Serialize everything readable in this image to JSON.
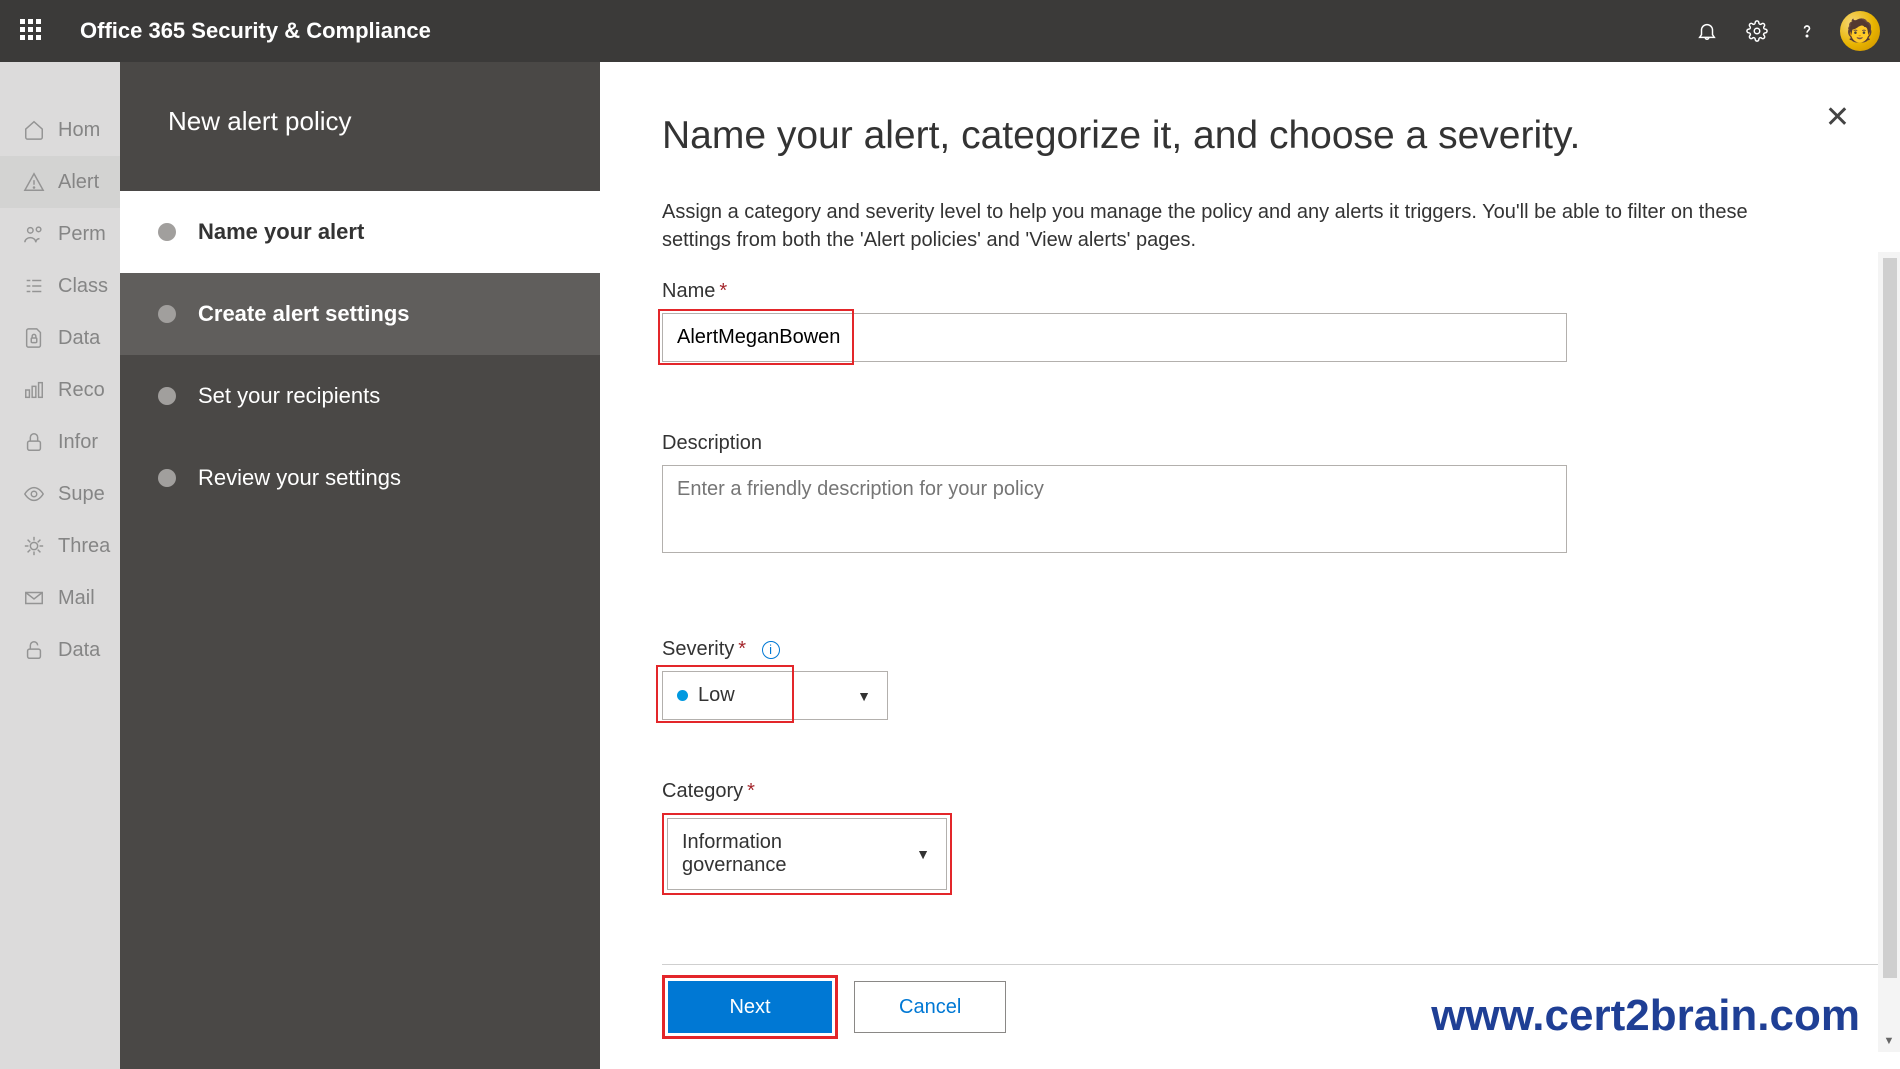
{
  "header": {
    "app_title": "Office 365 Security & Compliance"
  },
  "left_nav": {
    "items": [
      {
        "label": "Hom"
      },
      {
        "label": "Alert"
      },
      {
        "label": "Perm"
      },
      {
        "label": "Class"
      },
      {
        "label": "Data"
      },
      {
        "label": "Reco"
      },
      {
        "label": "Infor"
      },
      {
        "label": "Supe"
      },
      {
        "label": "Threa"
      },
      {
        "label": "Mail"
      },
      {
        "label": "Data"
      }
    ]
  },
  "wizard": {
    "title": "New alert policy",
    "steps": [
      {
        "label": "Name your alert"
      },
      {
        "label": "Create alert settings"
      },
      {
        "label": "Set your recipients"
      },
      {
        "label": "Review your settings"
      }
    ]
  },
  "form": {
    "heading": "Name your alert, categorize it, and choose a severity.",
    "subtext": "Assign a category and severity level to help you manage the policy and any alerts it triggers. You'll be able to filter on these settings from both the 'Alert policies' and 'View alerts' pages.",
    "name_label": "Name",
    "name_value": "AlertMeganBowen",
    "desc_label": "Description",
    "desc_placeholder": "Enter a friendly description for your policy",
    "severity_label": "Severity",
    "severity_value": "Low",
    "category_label": "Category",
    "category_value": "Information governance",
    "next_label": "Next",
    "cancel_label": "Cancel"
  },
  "watermark": "www.cert2brain.com"
}
